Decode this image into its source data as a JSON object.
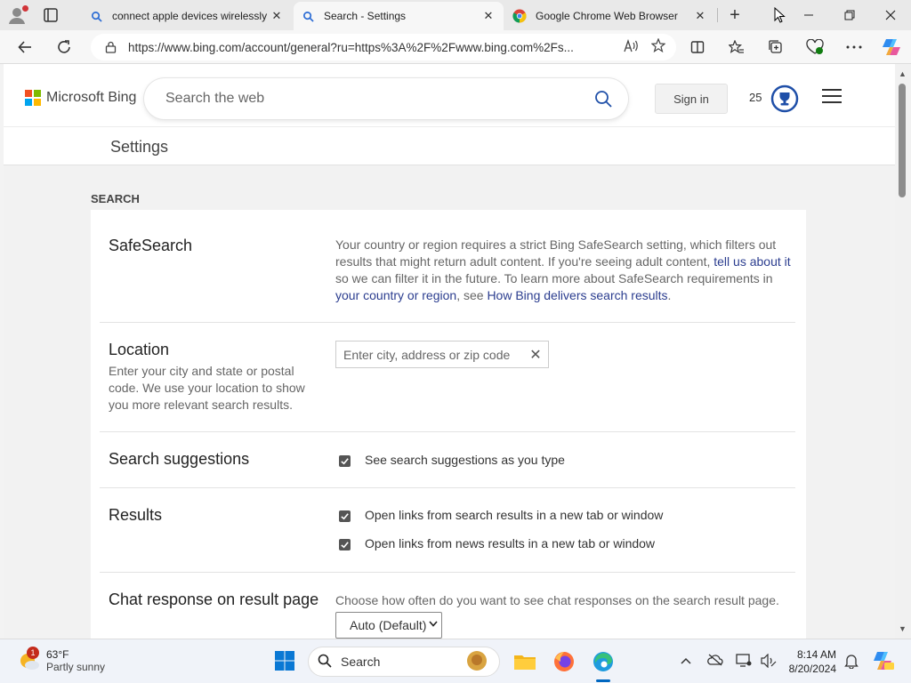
{
  "browser": {
    "tabs": [
      {
        "title": "connect apple devices wirelessly",
        "icon": "bing-search-icon"
      },
      {
        "title": "Search - Settings",
        "icon": "bing-search-icon",
        "active": true
      },
      {
        "title": "Google Chrome Web Browser",
        "icon": "chrome-icon"
      }
    ],
    "new_tab": "+",
    "url": "https://www.bing.com/account/general?ru=https%3A%2F%2Fwww.bing.com%2Fs..."
  },
  "bing": {
    "logo_text": "Microsoft Bing",
    "search_placeholder": "Search the web",
    "sign_in": "Sign in",
    "points": "25"
  },
  "settings": {
    "title": "Settings",
    "section": "SEARCH",
    "safesearch": {
      "title": "SafeSearch",
      "text1": "Your country or region requires a strict Bing SafeSearch setting, which filters out results that might return adult content. If you're seeing adult content, ",
      "link1": "tell us about it",
      "text2": " so we can filter it in the future. To learn more about SafeSearch requirements in ",
      "link2": "your country or region",
      "text3": ", see ",
      "link3": "How Bing delivers search results",
      "text4": "."
    },
    "location": {
      "title": "Location",
      "desc": "Enter your city and state or postal code. We use your location to show you more relevant search results.",
      "placeholder": "Enter city, address or zip code",
      "clear": "✕"
    },
    "suggestions": {
      "title": "Search suggestions",
      "option": "See search suggestions as you type",
      "checked": true
    },
    "results": {
      "title": "Results",
      "option1": "Open links from search results in a new tab or window",
      "option2": "Open links from news results in a new tab or window",
      "checked1": true,
      "checked2": true
    },
    "chat": {
      "title": "Chat response on result page",
      "desc": "Choose how often do you want to see chat responses on the search result page.",
      "selected": "Auto (Default)"
    }
  },
  "taskbar": {
    "weather_badge": "1",
    "temperature": "63°F",
    "condition": "Partly sunny",
    "search_label": "Search",
    "time": "8:14 AM",
    "date": "8/20/2024"
  },
  "colors": {
    "ms_red": "#f25022",
    "ms_green": "#7fba00",
    "ms_blue": "#00a4ef",
    "ms_yellow": "#ffb900",
    "link": "#2b3d8f",
    "reward_blue": "#1f4fa8"
  }
}
